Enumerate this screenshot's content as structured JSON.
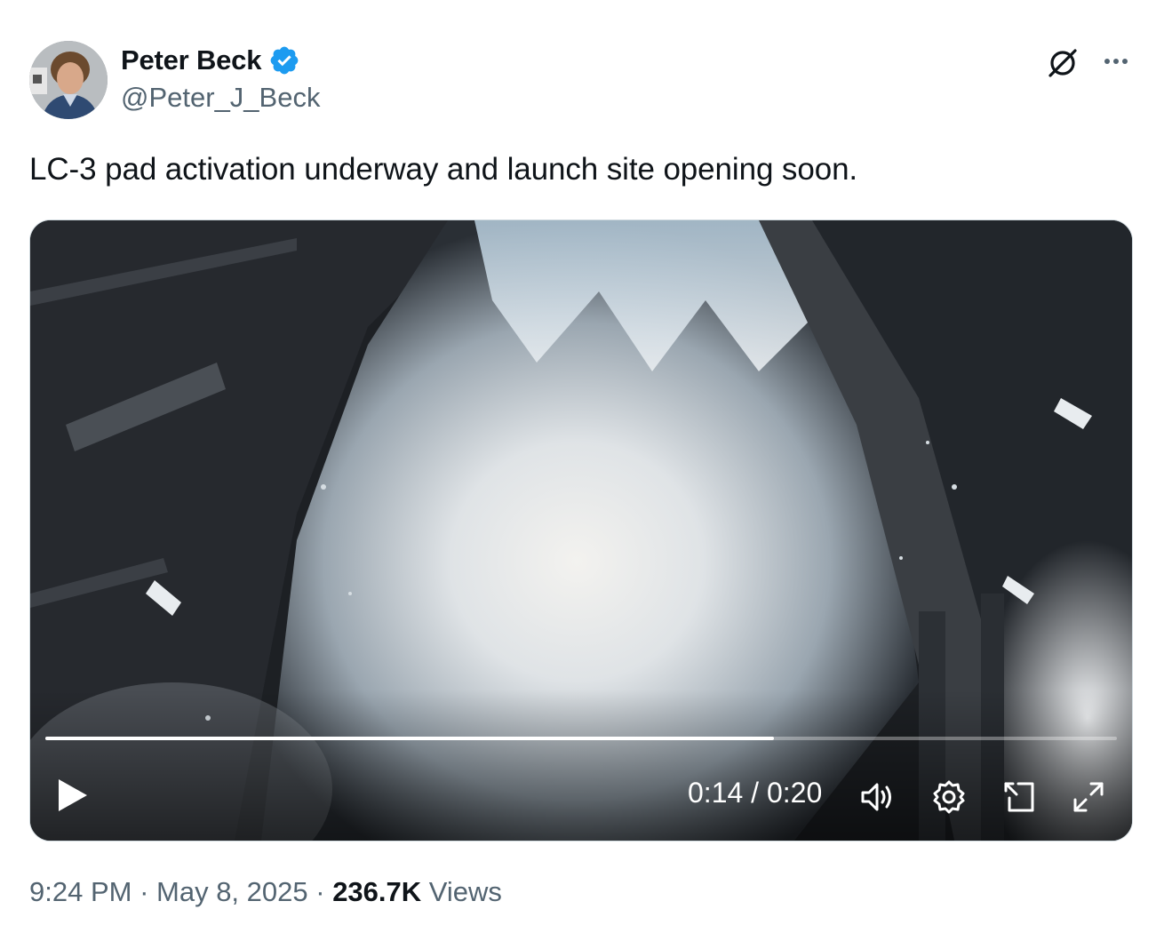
{
  "author": {
    "name": "Peter Beck",
    "handle": "@Peter_J_Beck",
    "verified_color": "#1d9bf0"
  },
  "header_icons": [
    "grok-icon",
    "more-icon"
  ],
  "tweet": {
    "text": "LC-3 pad activation underway and launch site opening soon."
  },
  "video": {
    "time_label": "0:14 / 0:20",
    "progress": 0.68,
    "controls": [
      "play-icon",
      "volume-icon",
      "settings-icon",
      "picture-in-picture-icon",
      "fullscreen-icon"
    ]
  },
  "footer": {
    "time": "9:24 PM",
    "sep1": " · ",
    "date": "May 8, 2025",
    "sep2": " · ",
    "views_count": "236.7K",
    "views_label": " Views"
  }
}
